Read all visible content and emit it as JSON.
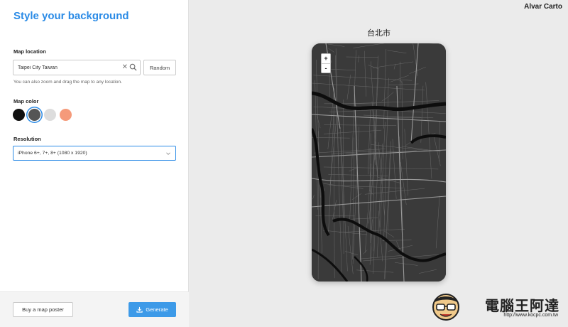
{
  "panel": {
    "title": "Style your background",
    "map_location_label": "Map location",
    "location_value": "Taipei City Taiwan",
    "random_label": "Random",
    "hint": "You can also zoom and drag the map to any location.",
    "map_color_label": "Map color",
    "colors": [
      "#111111",
      "#555555",
      "#dddddd",
      "#f59a7a"
    ],
    "selected_color_index": 1,
    "resolution_label": "Resolution",
    "resolution_value": "iPhone 6+, 7+, 8+ (1080 x 1920)",
    "buy_poster_label": "Buy a map poster",
    "generate_label": "Generate"
  },
  "stage": {
    "brand": "Alvar Carto",
    "map_title": "台北市",
    "zoom_in": "+",
    "zoom_out": "-"
  },
  "watermark": {
    "text": "電腦王阿達",
    "url": "http://www.kocpc.com.tw"
  }
}
